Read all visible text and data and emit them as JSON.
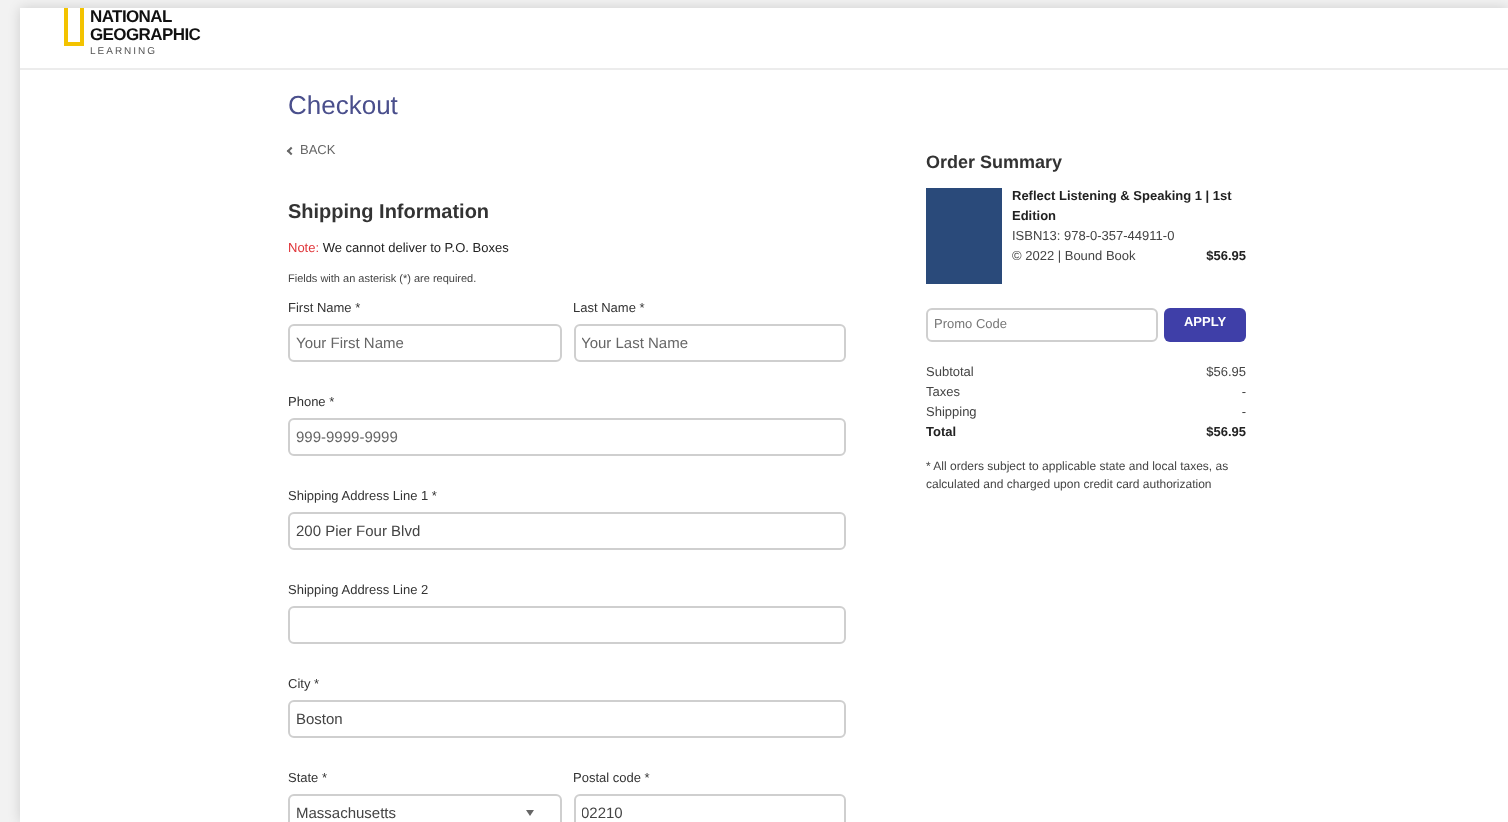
{
  "logo": {
    "lines": [
      "NATIONAL",
      "GEOGRAPHIC",
      "LEARNING"
    ]
  },
  "page_title": "Checkout",
  "back_link": "BACK",
  "shipping": {
    "title": "Shipping Information",
    "note_label": "Note:",
    "note": "We cannot deliver to P.O. Boxes",
    "required_hint": "Fields with an asterisk (*) are required.",
    "rows": [
      [
        {
          "kind": "text",
          "label": "First Name *",
          "placeholder": "Your First Name"
        },
        {
          "kind": "text",
          "label": "Last Name *",
          "placeholder": "Your Last Name"
        }
      ],
      [
        {
          "kind": "text",
          "label": "Phone *",
          "placeholder": "999-9999-9999"
        }
      ],
      [
        {
          "kind": "text",
          "label": "Shipping Address Line 1 *",
          "value": "200 Pier Four Blvd"
        }
      ],
      [
        {
          "kind": "text",
          "label": "Shipping Address Line 2"
        }
      ],
      [
        {
          "kind": "text",
          "label": "City *",
          "value": "Boston"
        }
      ],
      [
        {
          "kind": "select",
          "label": "State *",
          "value": "Massachusetts"
        },
        {
          "kind": "text",
          "label": "Postal code *",
          "value": "02210"
        }
      ]
    ]
  },
  "order_summary": {
    "title": "Order Summary",
    "product": {
      "title": "Reflect Listening & Speaking 1 | 1st Edition",
      "isbn": "ISBN13: 978-0-357-44911-0",
      "meta": "© 2022 | Bound Book",
      "price": "$56.95"
    },
    "promo": {
      "placeholder": "Promo Code",
      "button": "APPLY"
    },
    "totals": [
      {
        "label": "Subtotal",
        "value": "$56.95",
        "bold": false
      },
      {
        "label": "Taxes",
        "value": "-",
        "bold": false
      },
      {
        "label": "Shipping",
        "value": "-",
        "bold": false
      },
      {
        "label": "Total",
        "value": "$56.95",
        "bold": true
      }
    ],
    "footnote": "* All orders subject to applicable state and local taxes, as calculated and charged upon credit card authorization"
  }
}
